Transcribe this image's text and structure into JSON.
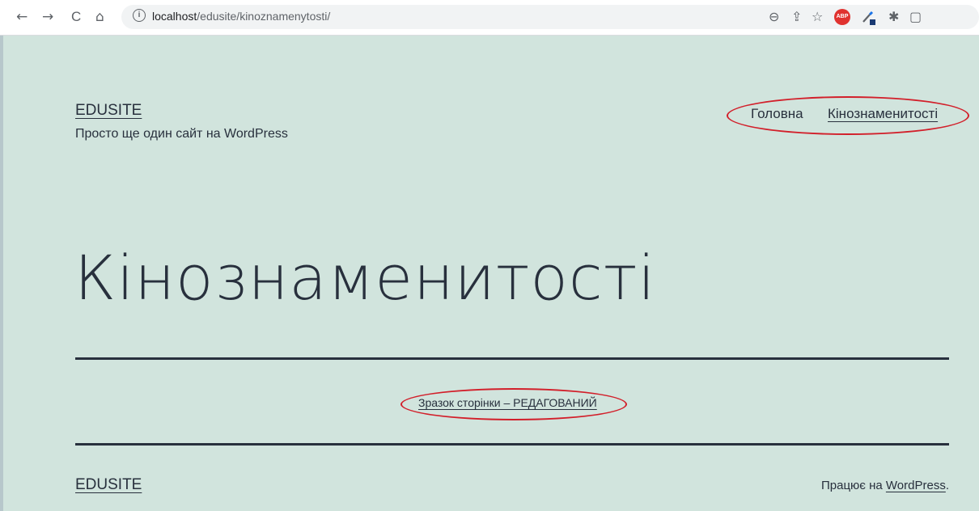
{
  "browser": {
    "back_icon": "←",
    "forward_icon": "→",
    "reload_icon": "C",
    "home_icon": "⌂",
    "info_icon": "i",
    "url_host": "localhost",
    "url_path": "/edusite/kinoznamenytosti/",
    "zoom_icon": "⊖",
    "share_icon": "⇪",
    "star_icon": "☆",
    "abp_label": "ABP",
    "extensions_icon": "✱",
    "sidepanel_icon": "▢"
  },
  "header": {
    "site_title": "EDUSITE",
    "tagline": "Просто ще один сайт на WordPress",
    "menu": [
      {
        "label": "Головна"
      },
      {
        "label": "Кінознаменитості"
      }
    ]
  },
  "main": {
    "page_title": "Кінознаменитості",
    "content_link": "Зразок сторінки – РЕДАГОВАНИЙ"
  },
  "footer": {
    "site_title": "EDUSITE",
    "powered_prefix": "Працює на ",
    "powered_link": "WordPress",
    "powered_suffix": "."
  },
  "colors": {
    "background": "#d1e4dd",
    "text": "#28303d",
    "annotation_ellipse": "#d21f2a"
  }
}
